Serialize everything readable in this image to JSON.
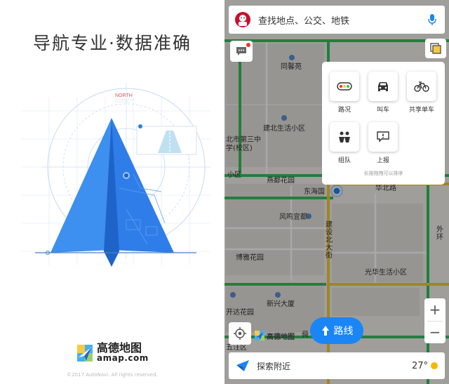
{
  "splash": {
    "headline": "导航专业·数据准确",
    "north_label": "NORTH",
    "brand_name": "高德地图",
    "brand_domain": "amap.com",
    "copyright": "©2017 AutoNavi. All rights reserved."
  },
  "map": {
    "search_placeholder": "查找地点、公交、地铁",
    "labels": [
      {
        "id": "tongfu",
        "text": "同馨苑"
      },
      {
        "id": "jiansheng",
        "text": "建北生活小区"
      },
      {
        "id": "school",
        "text": "北市第三中学(校区)"
      },
      {
        "id": "xiaoqu",
        "text": "小区"
      },
      {
        "id": "yanhua",
        "text": "燕都花园"
      },
      {
        "id": "donghai",
        "text": "东海国"
      },
      {
        "id": "huabei",
        "text": "华北路"
      },
      {
        "id": "fengming",
        "text": "风鸣宜都"
      },
      {
        "id": "jianshe",
        "text": "建设北大街"
      },
      {
        "id": "boyang",
        "text": "博雅花园"
      },
      {
        "id": "guangsheng",
        "text": "光华生活小区"
      },
      {
        "id": "kaiyuan",
        "text": "开达花园"
      },
      {
        "id": "xinxing",
        "text": "新兴大厦"
      },
      {
        "id": "wai",
        "text": "外环"
      },
      {
        "id": "wuxing",
        "text": "五汪区"
      },
      {
        "id": "partial",
        "text": "舜"
      }
    ],
    "tools": [
      {
        "id": "traffic",
        "label": "路况",
        "icon": "traffic-light-icon"
      },
      {
        "id": "taxi",
        "label": "叫车",
        "icon": "car-icon"
      },
      {
        "id": "bike",
        "label": "共享单车",
        "icon": "bicycle-icon"
      },
      {
        "id": "team",
        "label": "组队",
        "icon": "group-icon"
      },
      {
        "id": "report",
        "label": "上报",
        "icon": "report-icon"
      }
    ],
    "tools_hint": "长按拖拽可以排序",
    "route_label": "路线",
    "map_logo_text": "高德地图",
    "zoom_in": "+",
    "zoom_out": "−",
    "explore_label": "探索附近",
    "temperature": "27°",
    "colors": {
      "accent": "#1a85f5",
      "road_green": "#36c05e",
      "road_yellow": "#f6c83a",
      "splash_blue": "#2f7de8"
    }
  }
}
